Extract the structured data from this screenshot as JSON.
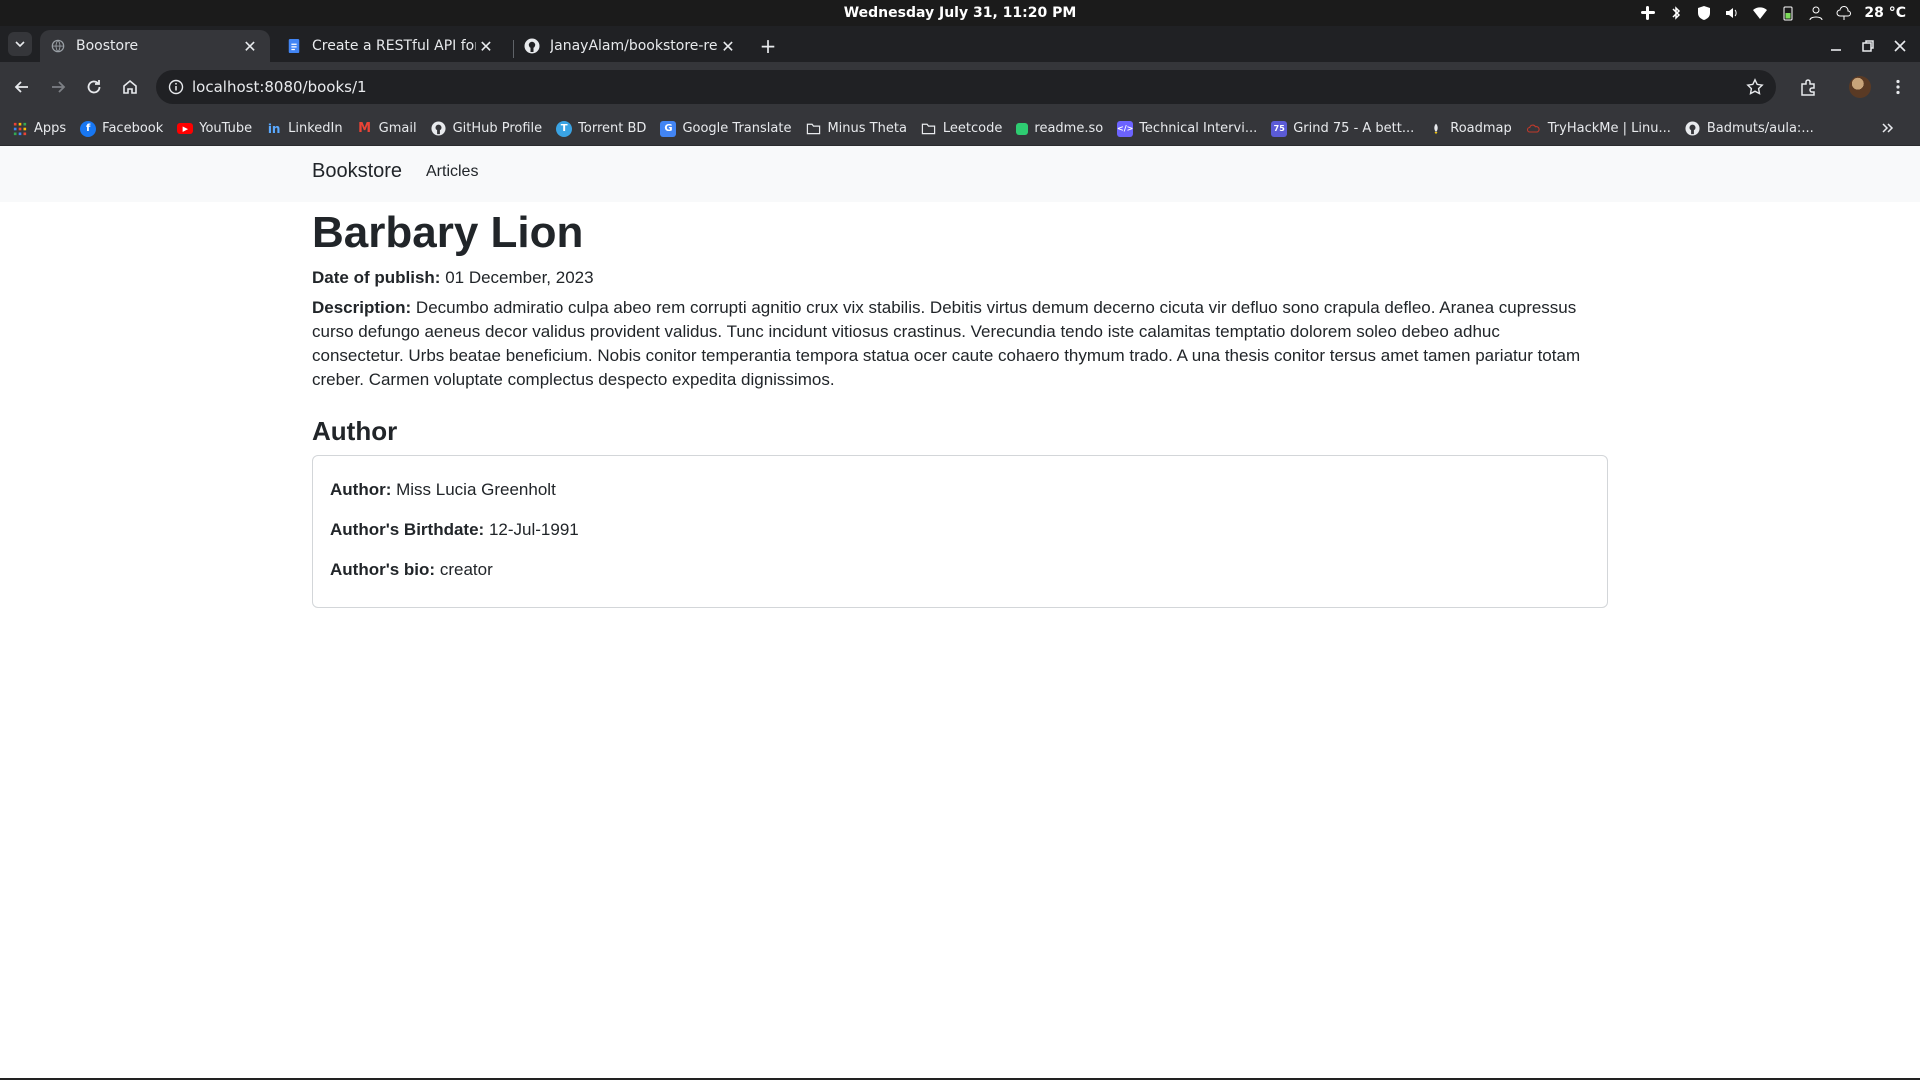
{
  "os": {
    "clock": "Wednesday July 31, 11:20 PM",
    "weather": "28 °C"
  },
  "browser": {
    "tabs": [
      {
        "label": "Boostore",
        "active": true
      },
      {
        "label": "Create a RESTful API for a Bo",
        "active": false
      },
      {
        "label": "JanayAlam/bookstore-rest",
        "active": false
      }
    ],
    "url": "localhost:8080/books/1",
    "bookmarks": [
      {
        "label": "Apps",
        "icon": "apps-grid-icon",
        "color": "#ea4335"
      },
      {
        "label": "Facebook",
        "icon": "facebook-icon",
        "color": "#1877f2"
      },
      {
        "label": "YouTube",
        "icon": "youtube-icon",
        "color": "#ff0000"
      },
      {
        "label": "LinkedIn",
        "icon": "linkedin-icon",
        "color": "#0a66c2"
      },
      {
        "label": "Gmail",
        "icon": "gmail-icon",
        "color": "#ea4335"
      },
      {
        "label": "GitHub Profile",
        "icon": "github-icon",
        "color": "#e8eaed"
      },
      {
        "label": "Torrent BD",
        "icon": "torrent-icon",
        "color": "#3aa3e3"
      },
      {
        "label": "Google Translate",
        "icon": "translate-icon",
        "color": "#4285f4"
      },
      {
        "label": "Minus Theta",
        "icon": "folder-icon",
        "color": "#e8eaed"
      },
      {
        "label": "Leetcode",
        "icon": "folder-icon",
        "color": "#e8eaed"
      },
      {
        "label": "readme.so",
        "icon": "readme-icon",
        "color": "#2ecc71"
      },
      {
        "label": "Technical Intervi...",
        "icon": "code-icon",
        "color": "#6c63ff"
      },
      {
        "label": "Grind 75 - A bett...",
        "icon": "grind75-icon",
        "color": "#5b5bd6"
      },
      {
        "label": "Roadmap",
        "icon": "roadmap-icon",
        "color": "#f1c40f"
      },
      {
        "label": "TryHackMe | Linu...",
        "icon": "tryhackme-icon",
        "color": "#c0392b"
      },
      {
        "label": "Badmuts/aula:...",
        "icon": "github-icon",
        "color": "#e8eaed"
      }
    ]
  },
  "site": {
    "brand": "Bookstore",
    "nav_articles": "Articles"
  },
  "book": {
    "title": "Barbary Lion",
    "publish_label": "Date of publish:",
    "publish_value": "01 December, 2023",
    "description_label": "Description:",
    "description_value": "Decumbo admiratio culpa abeo rem corrupti agnitio crux vix stabilis. Debitis virtus demum decerno cicuta vir defluo sono crapula defleo. Aranea cupressus curso defungo aeneus decor validus provident validus. Tunc incidunt vitiosus crastinus. Verecundia tendo iste calamitas temptatio dolorem soleo debeo adhuc consectetur. Urbs beatae beneficium. Nobis conitor temperantia tempora statua ocer caute cohaero thymum trado. A una thesis conitor tersus amet tamen pariatur totam creber. Carmen voluptate complectus despecto expedita dignissimos."
  },
  "author": {
    "heading": "Author",
    "name_label": "Author:",
    "name_value": "Miss Lucia Greenholt",
    "birth_label": "Author's Birthdate:",
    "birth_value": "12-Jul-1991",
    "bio_label": "Author's bio:",
    "bio_value": "creator"
  }
}
